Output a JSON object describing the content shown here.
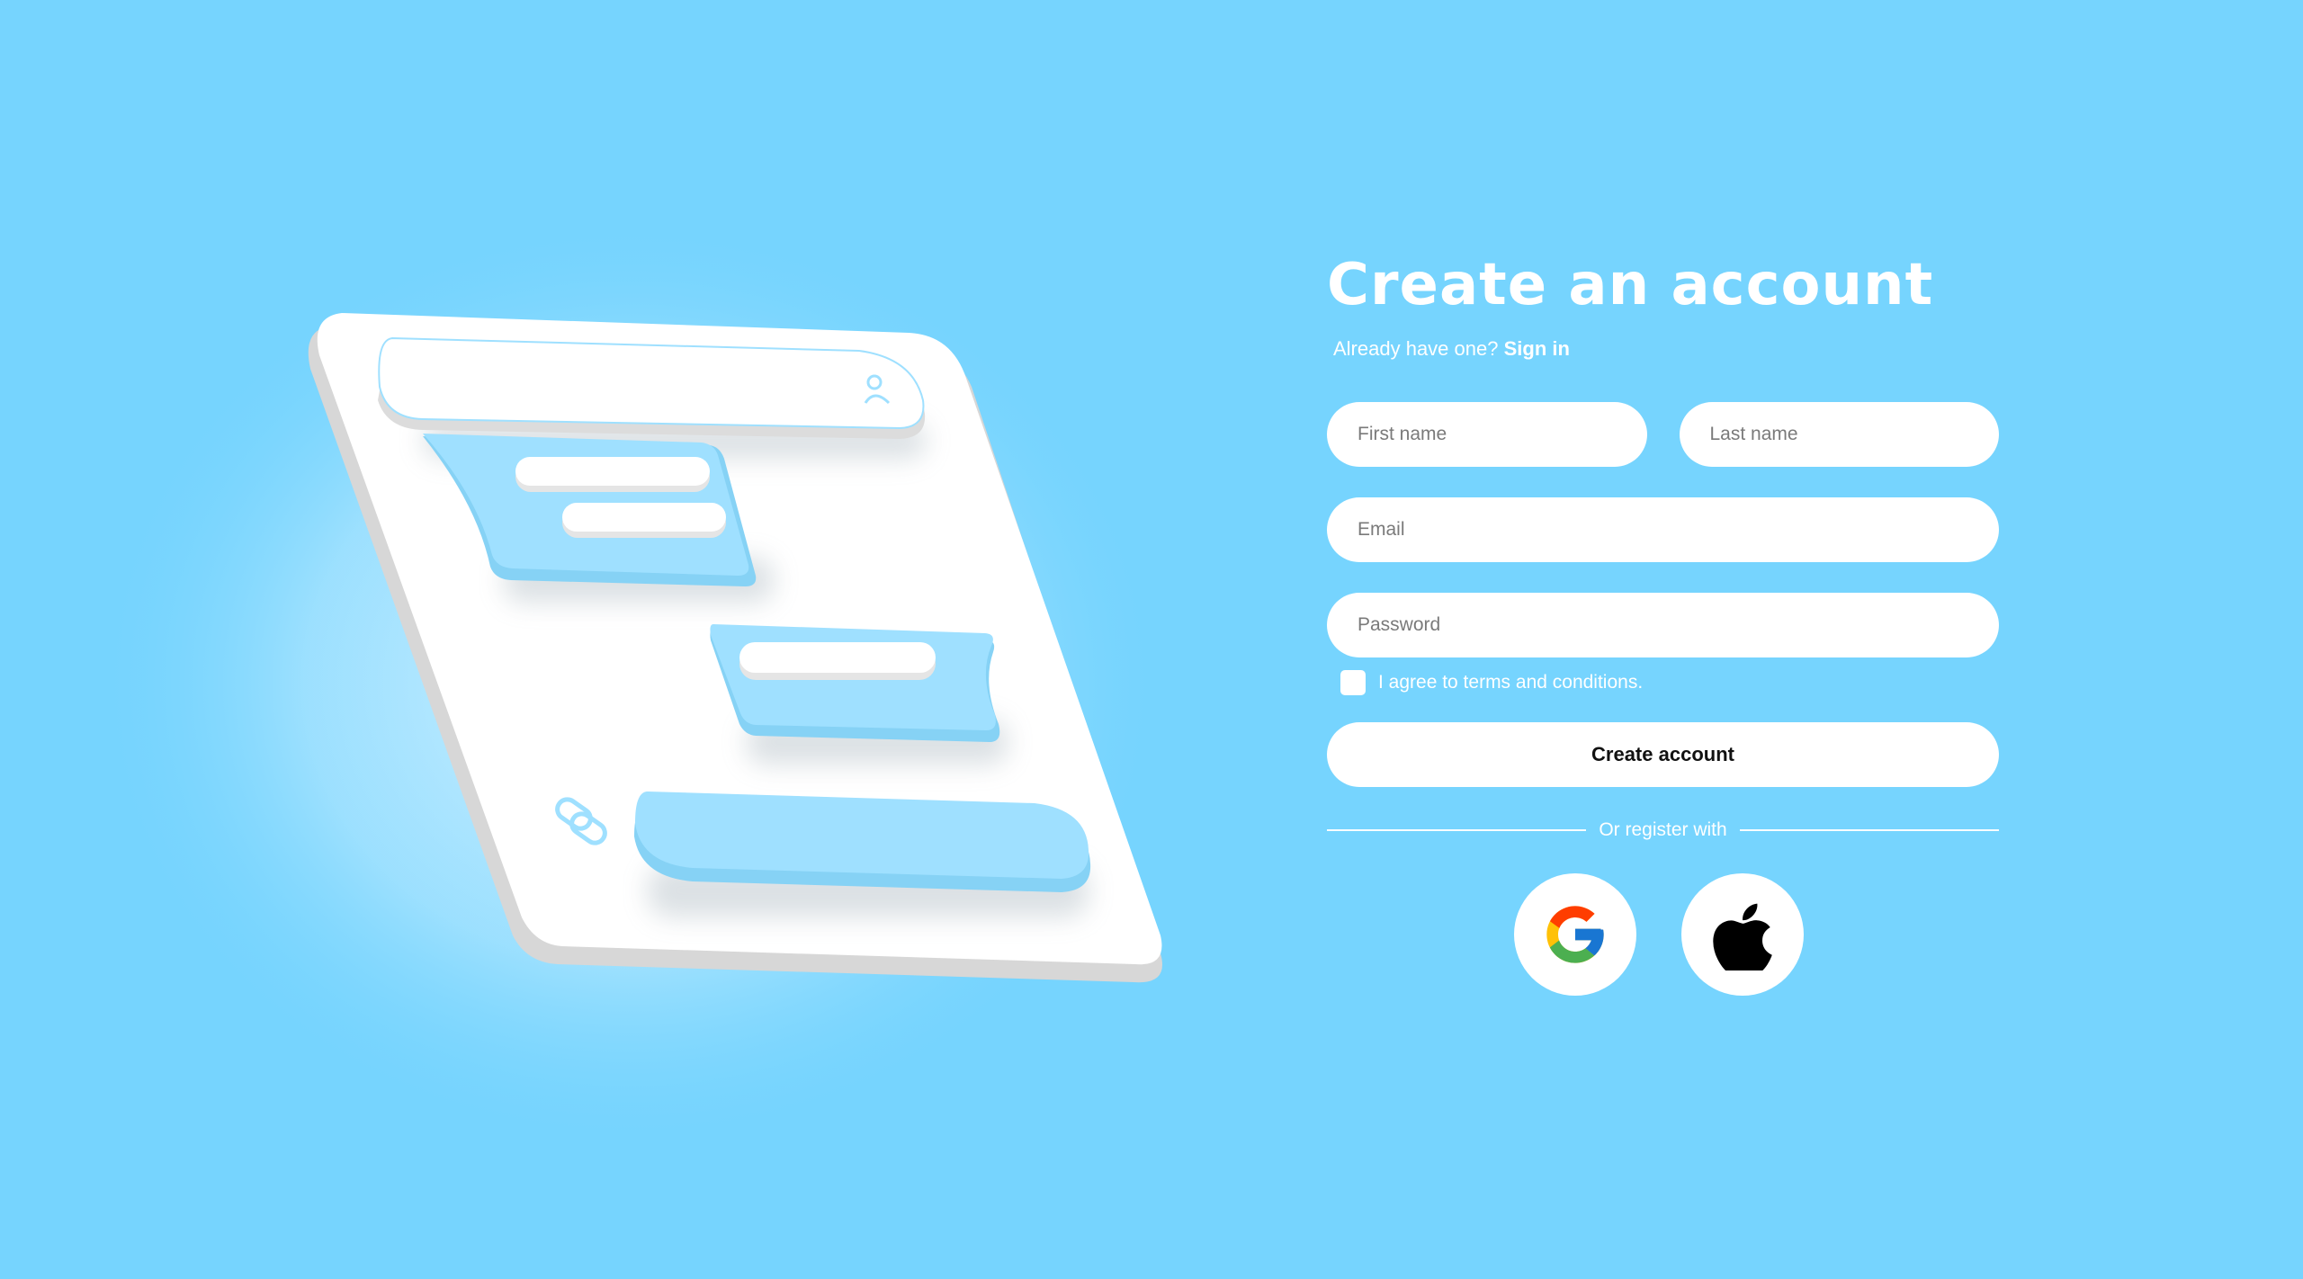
{
  "form": {
    "title": "Create an account",
    "signin_prompt": "Already have one?",
    "signin_link": "Sign in",
    "first_name_placeholder": "First name",
    "last_name_placeholder": "Last name",
    "email_placeholder": "Email",
    "password_placeholder": "Password",
    "terms_label": "I agree to terms and conditions.",
    "terms_checked": false,
    "submit_label": "Create account",
    "divider_text": "Or register with"
  },
  "socials": [
    {
      "name": "google",
      "icon": "google-icon"
    },
    {
      "name": "apple",
      "icon": "apple-icon"
    }
  ],
  "colors": {
    "background": "#76d4fe",
    "card": "#ffffff",
    "bubble": "#9fe0ff",
    "text_on_background": "#ffffff",
    "button_text": "#111111"
  }
}
